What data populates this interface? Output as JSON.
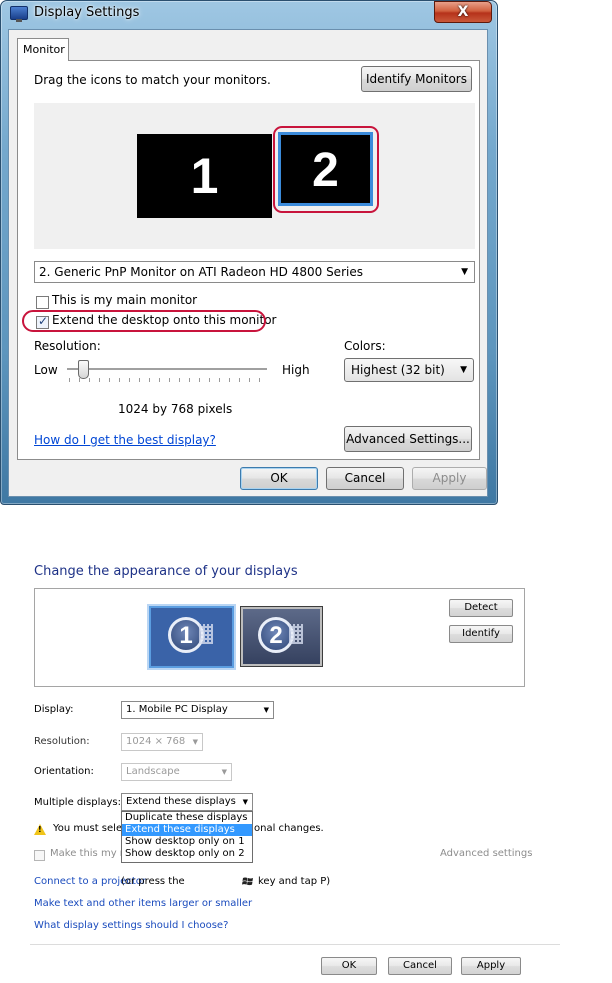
{
  "vista": {
    "title": "Display Settings",
    "close_glyph": "X",
    "tab": "Monitor",
    "drag_text": "Drag the icons to match your monitors.",
    "identify_button": "Identify Monitors",
    "monitors": [
      "1",
      "2"
    ],
    "display_select": "2. Generic PnP Monitor on ATI Radeon HD 4800 Series",
    "main_monitor_label": "This is my main monitor",
    "main_monitor_checked": false,
    "extend_label": "Extend the desktop onto this monitor",
    "extend_checked": true,
    "resolution_label": "Resolution:",
    "low": "Low",
    "high": "High",
    "resolution_value": "1024 by 768 pixels",
    "colors_label": "Colors:",
    "colors_value": "Highest (32 bit)",
    "help_link": "How do I get the best display?",
    "advanced_button": "Advanced Settings...",
    "ok": "OK",
    "cancel": "Cancel",
    "apply": "Apply",
    "highlight_color": "#c8143c"
  },
  "win7": {
    "title": "Change the appearance of your displays",
    "monitors": [
      "1",
      "2"
    ],
    "detect": "Detect",
    "identify": "Identify",
    "display_label": "Display:",
    "display_value": "1. Mobile PC Display",
    "resolution_label": "Resolution:",
    "resolution_value": "1024 × 768",
    "orientation_label": "Orientation:",
    "orientation_value": "Landscape",
    "multiple_label": "Multiple displays:",
    "multiple_value": "Extend these displays",
    "dropdown_options": [
      "Duplicate these displays",
      "Extend these displays",
      "Show desktop only on 1",
      "Show desktop only on 2"
    ],
    "dropdown_selected_index": 1,
    "warning_text": "You must select",
    "warning_tail": "onal changes.",
    "main_display_label": "Make this my ma",
    "advanced_settings": "Advanced settings",
    "link_projector": "Connect to a projector",
    "link_projector_rest": "(or press the",
    "link_projector_end": "key and tap P)",
    "link_text_size": "Make text and other items larger or smaller",
    "link_which_settings": "What display settings should I choose?",
    "ok": "OK",
    "cancel": "Cancel",
    "apply": "Apply",
    "icons": {
      "warning": "warning-icon",
      "windows_key": "windows-logo-icon"
    }
  }
}
